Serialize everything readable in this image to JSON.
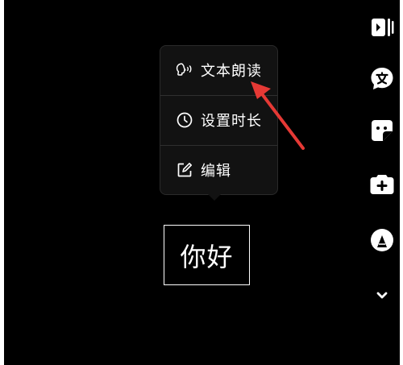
{
  "colors": {
    "background": "#000000",
    "menu_background": "#121212",
    "text": "#ffffff",
    "annotation_arrow": "#e53935"
  },
  "menu": {
    "items": [
      {
        "label": "文本朗读",
        "icon": "voice-reading-icon"
      },
      {
        "label": "设置时长",
        "icon": "clock-icon"
      },
      {
        "label": "编辑",
        "icon": "edit-icon"
      }
    ]
  },
  "sticker": {
    "text": "你好"
  },
  "toolbar": {
    "items": [
      {
        "icon": "split-screen-icon"
      },
      {
        "icon": "text-bubble-icon"
      },
      {
        "icon": "sticker-icon"
      },
      {
        "icon": "add-effect-icon"
      },
      {
        "icon": "pen-icon"
      },
      {
        "icon": "chevron-down-icon"
      }
    ]
  }
}
